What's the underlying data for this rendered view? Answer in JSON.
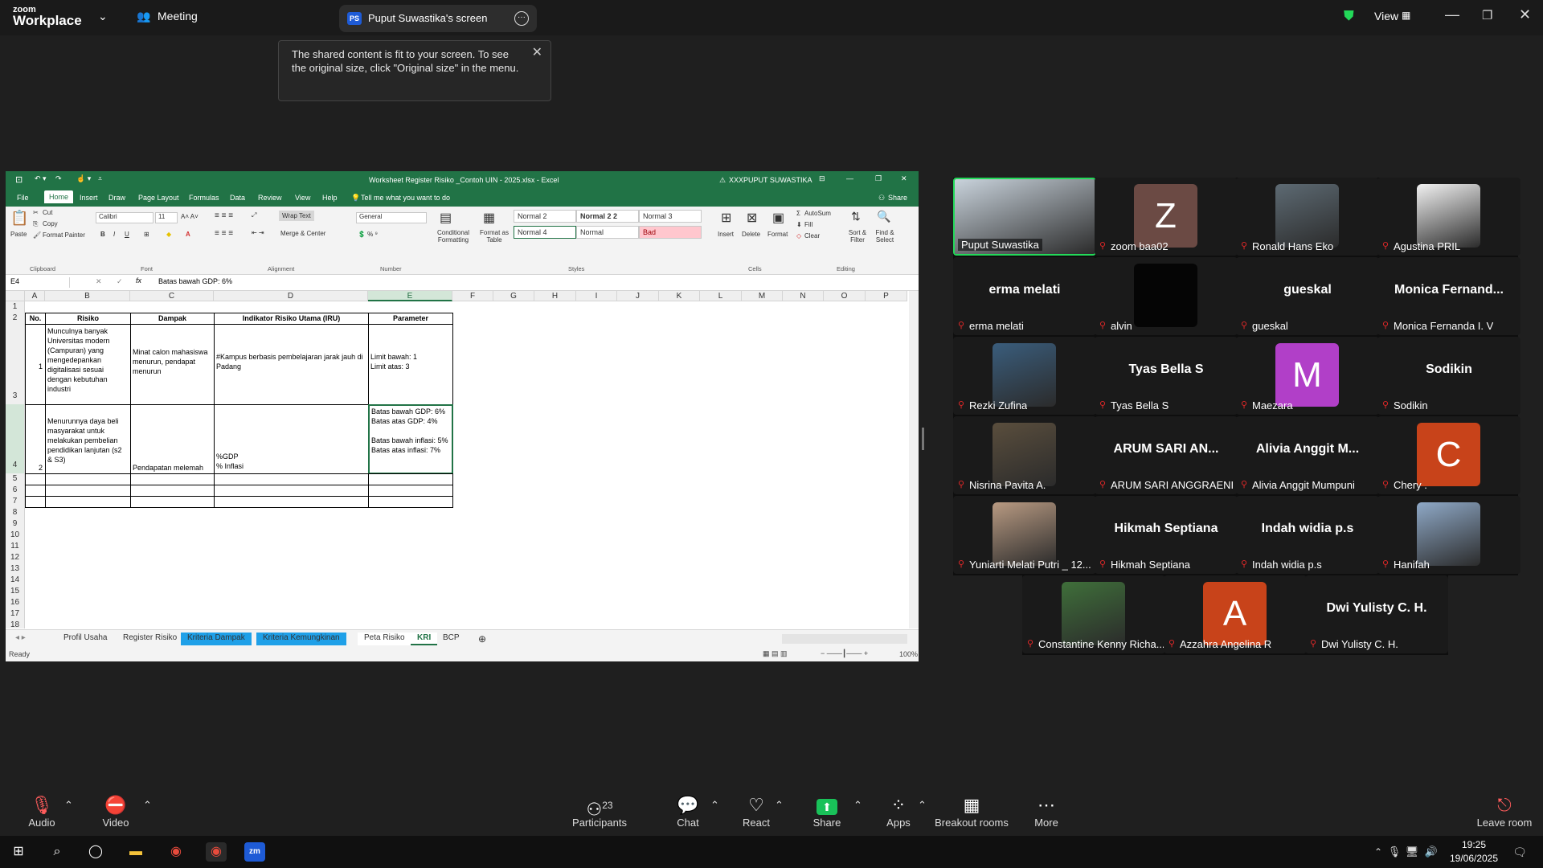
{
  "zoom": {
    "logo_top": "zoom",
    "logo_bottom": "Workplace",
    "meeting_label": "Meeting",
    "share_badge": "PS",
    "share_title": "Puput Suwastika's screen",
    "tooltip": "The shared content is fit to your screen. To see the original size, click \"Original size\" in the menu.",
    "view_label": "View"
  },
  "excel": {
    "title": "Worksheet Register Risiko _Contoh UIN - 2025.xlsx - Excel",
    "user": "XXXPUPUT SUWASTIKA",
    "share_btn": "Share",
    "menu": [
      "File",
      "Home",
      "Insert",
      "Draw",
      "Page Layout",
      "Formulas",
      "Data",
      "Review",
      "View",
      "Help"
    ],
    "tell_me": "Tell me what you want to do",
    "clipboard": {
      "paste": "Paste",
      "cut": "Cut",
      "copy": "Copy",
      "format_painter": "Format Painter",
      "group": "Clipboard"
    },
    "font": {
      "name": "Calibri",
      "size": "11",
      "group": "Font"
    },
    "alignment": {
      "wrap": "Wrap Text",
      "merge": "Merge & Center",
      "group": "Alignment"
    },
    "number": {
      "format": "General",
      "group": "Number"
    },
    "styles": {
      "cond": "Conditional Formatting",
      "fmt_table": "Format as Table",
      "normal2": "Normal 2",
      "normal22": "Normal 2 2",
      "normal3": "Normal 3",
      "normal4": "Normal 4",
      "normal": "Normal",
      "bad": "Bad",
      "group": "Styles"
    },
    "cells": {
      "insert": "Insert",
      "delete": "Delete",
      "format": "Format",
      "group": "Cells"
    },
    "editing": {
      "autosum": "AutoSum",
      "fill": "Fill",
      "clear": "Clear",
      "sort": "Sort & Filter",
      "find": "Find & Select",
      "group": "Editing"
    },
    "name_box": "E4",
    "formula": "Batas bawah GDP: 6%",
    "columns": [
      "A",
      "B",
      "C",
      "D",
      "E",
      "F",
      "G",
      "H",
      "I",
      "J",
      "K",
      "L",
      "M",
      "N",
      "O",
      "P"
    ],
    "rows": [
      "1",
      "2",
      "3",
      "4",
      "5",
      "6",
      "7",
      "8",
      "9",
      "10",
      "11",
      "12",
      "13",
      "14",
      "15",
      "16",
      "17",
      "18"
    ],
    "table_headers": [
      "No.",
      "Risiko",
      "Dampak",
      "Indikator Risiko Utama (IRU)",
      "Parameter"
    ],
    "row1": {
      "no": "1",
      "risiko": "Munculnya banyak Universitas modern (Campuran) yang mengedepankan digitalisasi sesuai dengan kebutuhan industri",
      "dampak": "Minat calon mahasiswa menurun, pendapat menurun",
      "iru": "#Kampus berbasis pembelajaran jarak jauh di Padang",
      "param": "Limit bawah: 1\nLimit atas: 3"
    },
    "row2": {
      "no": "2",
      "risiko": "Menurunnya daya beli masyarakat untuk melakukan pembelian pendidikan lanjutan (s2 & S3)",
      "dampak": "Pendapatan melemah",
      "iru": "%GDP\n% Inflasi",
      "param": "Batas bawah GDP: 6%\nBatas atas GDP: 4%\n\nBatas bawah inflasi: 5%\nBatas atas inflasi: 7%"
    },
    "sheets": [
      "Profil Usaha",
      "Register Risiko",
      "Kriteria Dampak",
      "Kriteria Kemungkinan",
      "Peta Risiko",
      "KRI",
      "BCP"
    ],
    "status": "Ready",
    "zoom": "100%"
  },
  "participants": [
    {
      "name": "Puput Suwastika",
      "type": "photo",
      "color": "#c9d3dc"
    },
    {
      "name": "zoom baa02",
      "type": "avatar",
      "letter": "Z",
      "color": "#6b4a44"
    },
    {
      "name": "Ronald Hans Eko",
      "type": "photo",
      "color": "#5d6a73"
    },
    {
      "name": "Agustina PRIL",
      "type": "photo",
      "color": "#f2f2f2"
    },
    {
      "name": "erma melati",
      "type": "text",
      "big": "erma melati"
    },
    {
      "name": "alvin",
      "type": "avatar",
      "letter": "",
      "color": "#050505"
    },
    {
      "name": "gueskal",
      "type": "text",
      "big": "gueskal"
    },
    {
      "name": "Monica Fernanda I. V",
      "type": "text",
      "big": "Monica  Fernand..."
    },
    {
      "name": "Rezki Zufina",
      "type": "photo",
      "color": "#3a5d7c"
    },
    {
      "name": "Tyas Bella S",
      "type": "text",
      "big": "Tyas Bella S"
    },
    {
      "name": "Maezara",
      "type": "avatar",
      "letter": "M",
      "color": "#b13fc8"
    },
    {
      "name": "Sodikin",
      "type": "text",
      "big": "Sodikin"
    },
    {
      "name": "Nisrina Pavita A.",
      "type": "photo",
      "color": "#5a4e3d"
    },
    {
      "name": "ARUM SARI ANGGRAENI",
      "type": "text",
      "big": "ARUM SARI AN..."
    },
    {
      "name": "Alivia Anggit Mumpuni",
      "type": "text",
      "big": "Alivia Anggit  M..."
    },
    {
      "name": "Chery .",
      "type": "avatar",
      "letter": "C",
      "color": "#c8431a"
    },
    {
      "name": "Yuniarti Melati Putri _ 12...",
      "type": "photo",
      "color": "#b89a82"
    },
    {
      "name": "Hikmah Septiana",
      "type": "text",
      "big": "Hikmah Septiana"
    },
    {
      "name": "Indah widia p.s",
      "type": "text",
      "big": "Indah widia p.s"
    },
    {
      "name": "Hanifah",
      "type": "photo",
      "color": "#8fa9c7"
    },
    {
      "name": "Constantine Kenny Richa...",
      "type": "photo",
      "color": "#3f6f3a"
    },
    {
      "name": "Azzahra Angelina R",
      "type": "avatar",
      "letter": "A",
      "color": "#c8431a"
    },
    {
      "name": "Dwi Yulisty C. H.",
      "type": "text",
      "big": "Dwi Yulisty C. H."
    }
  ],
  "toolbar": {
    "audio": "Audio",
    "video": "Video",
    "participants": "Participants",
    "participants_count": "23",
    "chat": "Chat",
    "react": "React",
    "share": "Share",
    "apps": "Apps",
    "breakout": "Breakout rooms",
    "more": "More",
    "leave": "Leave room"
  },
  "taskbar": {
    "time": "19:25",
    "date": "19/06/2025"
  },
  "colors": {
    "excel_green": "#217346",
    "zoom_green": "#23d959",
    "share_green": "#19c159",
    "mute_red": "#e02828"
  }
}
